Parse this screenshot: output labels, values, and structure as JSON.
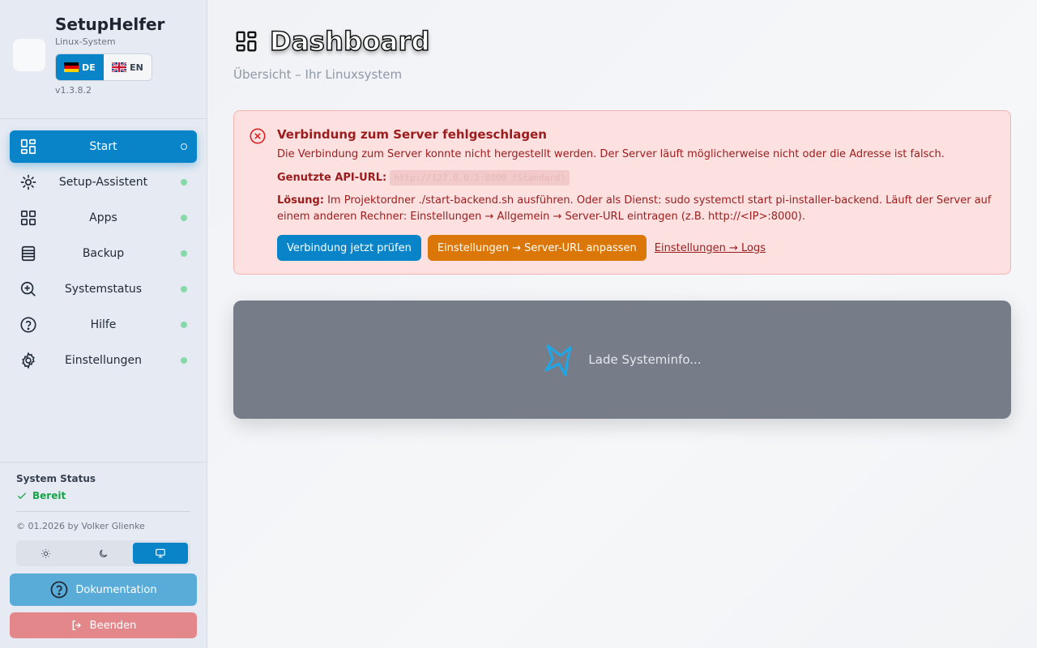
{
  "brand": {
    "app_name": "SetupHelfer",
    "subtitle": "Linux-System",
    "version": "v1.3.8.2",
    "languages": [
      {
        "code": "DE",
        "flag": "de-flag-icon",
        "active": true
      },
      {
        "code": "EN",
        "flag": "uk-flag-icon",
        "active": false
      }
    ]
  },
  "sidebar": {
    "items": [
      {
        "label": "Start",
        "icon": "dashboard-icon",
        "active": true
      },
      {
        "label": "Setup-Assistent",
        "icon": "sparkle-icon",
        "active": false
      },
      {
        "label": "Apps",
        "icon": "apps-grid-icon",
        "active": false
      },
      {
        "label": "Backup",
        "icon": "database-icon",
        "active": false
      },
      {
        "label": "Systemstatus",
        "icon": "zoom-in-icon",
        "active": false
      },
      {
        "label": "Hilfe",
        "icon": "help-circle-icon",
        "active": false
      },
      {
        "label": "Einstellungen",
        "icon": "gear-icon",
        "active": false
      }
    ],
    "system_status_title": "System Status",
    "system_status_value": "Bereit",
    "copyright": "© 01.2026 by Volker Glienke",
    "theme_options": [
      "sun-icon",
      "moon-icon",
      "monitor-icon"
    ],
    "theme_active": "monitor-icon",
    "documentation_label": "Dokumentation",
    "quit_label": "Beenden"
  },
  "main": {
    "title": "Dashboard",
    "subtitle": "Übersicht – Ihr Linuxsystem",
    "alert": {
      "title": "Verbindung zum Server fehlgeschlagen",
      "text": "Die Verbindung zum Server konnte nicht hergestellt werden. Der Server läuft möglicherweise nicht oder die Adresse ist falsch.",
      "api_label": "Genutzte API-URL:",
      "api_url": "http://127.0.0.1:8000 (Standard)",
      "solution_label": "Lösung:",
      "solution_text": " Im Projektordner ./start-backend.sh ausführen. Oder als Dienst: sudo systemctl start pi-installer-backend. Läuft der Server auf einem anderen Rechner: Einstellungen → Allgemein → Server-URL eintragen (z.B. http://<IP>:8000).",
      "check_button": "Verbindung jetzt prüfen",
      "settings_button": "Einstellungen → Server-URL anpassen",
      "logs_link": "Einstellungen → Logs"
    },
    "loading_text": "Lade Systeminfo..."
  },
  "colors": {
    "accent": "#0a84c8",
    "error_bg": "#fde1e1",
    "error_text": "#9b1c1c",
    "warning_button": "#db7708",
    "ready": "#16a34a"
  }
}
